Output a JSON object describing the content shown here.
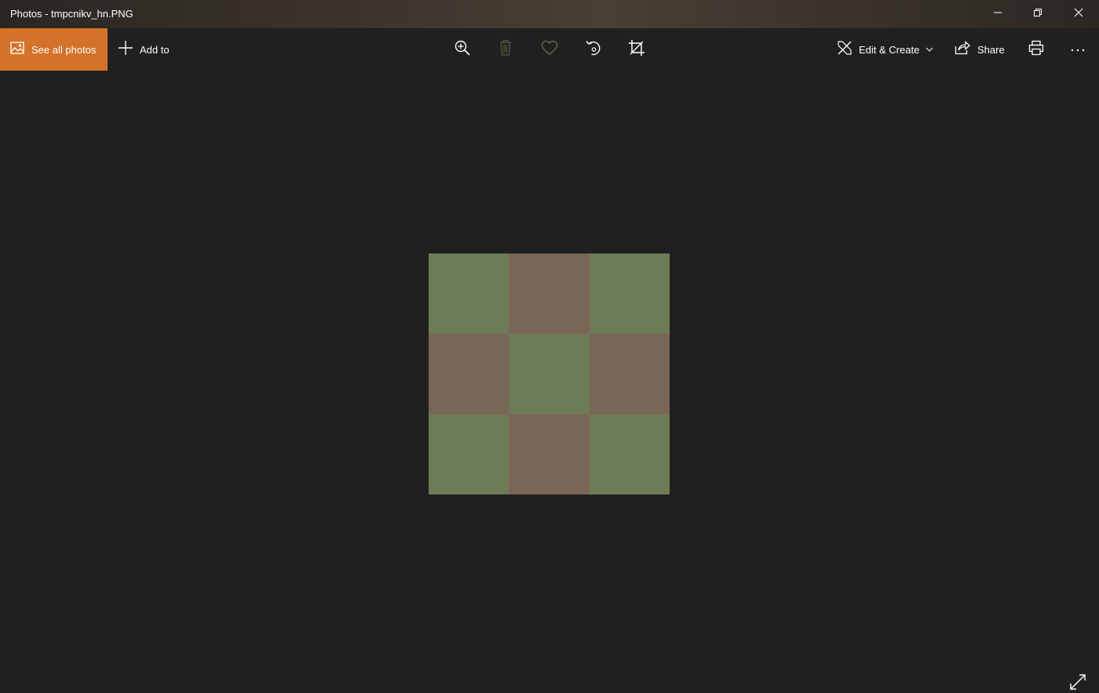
{
  "window": {
    "title": "Photos - tmpcnikv_hn.PNG"
  },
  "titlebar_buttons": {
    "minimize_icon": "minimize-icon",
    "restore_icon": "restore-icon",
    "close_icon": "close-icon"
  },
  "toolbar": {
    "see_all_label": "See all photos",
    "add_to_label": "Add to",
    "edit_create_label": "Edit & Create",
    "share_label": "Share",
    "icons": [
      "zoom-in-icon",
      "delete-icon",
      "favorite-icon",
      "rotate-icon",
      "crop-icon",
      "print-icon",
      "more-icon"
    ]
  },
  "colors": {
    "accent": "#d4722a",
    "background": "#202020",
    "photo_green": "#6e7b57",
    "photo_brown": "#7a6656",
    "disabled_icon": "#4f5a3a"
  },
  "photo": {
    "grid": [
      [
        "green",
        "brown",
        "green"
      ],
      [
        "brown",
        "green",
        "brown"
      ],
      [
        "green",
        "brown",
        "green"
      ]
    ]
  }
}
